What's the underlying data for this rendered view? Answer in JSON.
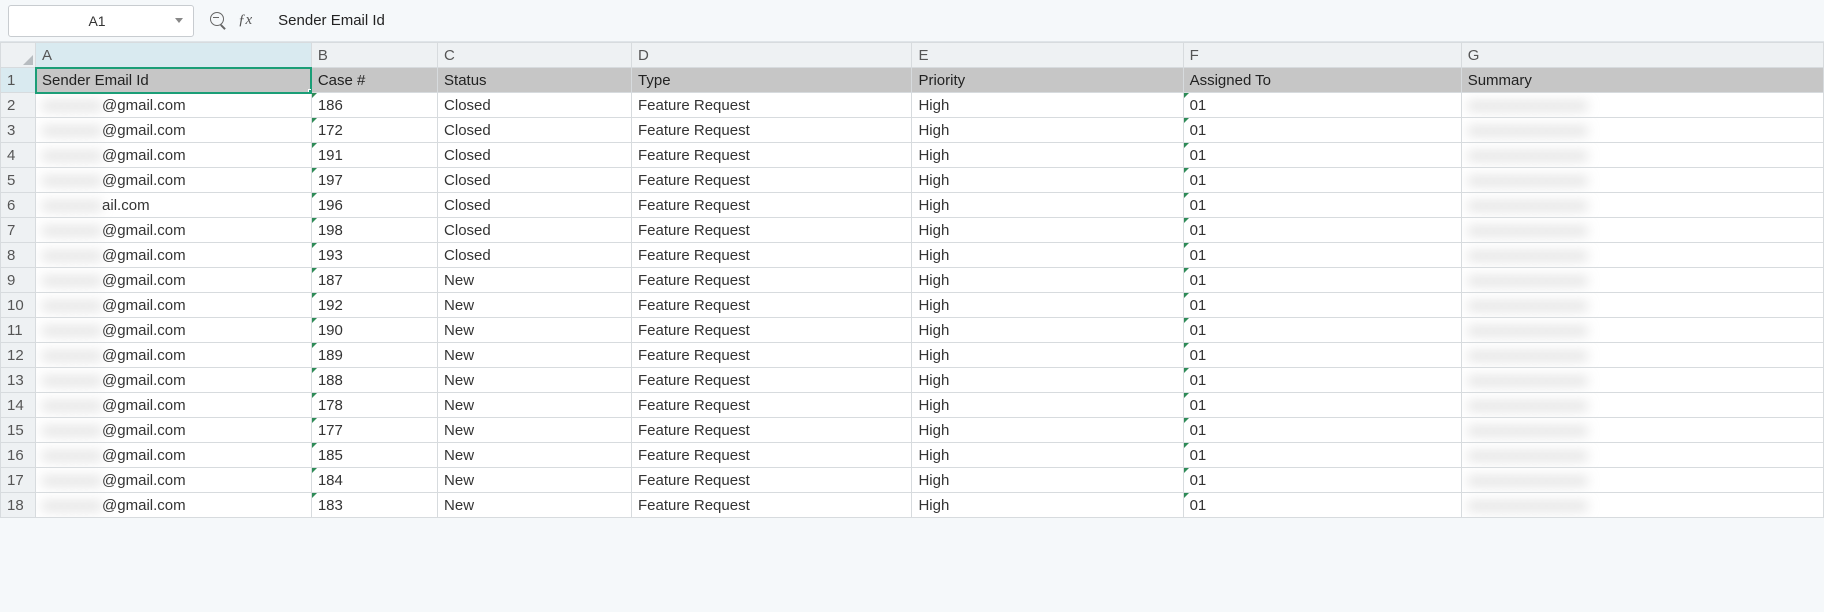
{
  "nameBox": "A1",
  "formula": "Sender Email Id",
  "columns": [
    "A",
    "B",
    "C",
    "D",
    "E",
    "F",
    "G"
  ],
  "headers": {
    "A": "Sender Email Id",
    "B": "Case #",
    "C": "Status",
    "D": "Type",
    "E": "Priority",
    "F": "Assigned To",
    "G": "Summary"
  },
  "rows": [
    {
      "n": 2,
      "email": "@gmail.com",
      "case": "186",
      "status": "Closed",
      "type": "Feature Request",
      "priority": "High",
      "assigned": "01",
      "summary": ""
    },
    {
      "n": 3,
      "email": "@gmail.com",
      "case": "172",
      "status": "Closed",
      "type": "Feature Request",
      "priority": "High",
      "assigned": "01",
      "summary": ""
    },
    {
      "n": 4,
      "email": "@gmail.com",
      "case": "191",
      "status": "Closed",
      "type": "Feature Request",
      "priority": "High",
      "assigned": "01",
      "summary": ""
    },
    {
      "n": 5,
      "email": "@gmail.com",
      "case": "197",
      "status": "Closed",
      "type": "Feature Request",
      "priority": "High",
      "assigned": "01",
      "summary": ""
    },
    {
      "n": 6,
      "email": "ail.com",
      "case": "196",
      "status": "Closed",
      "type": "Feature Request",
      "priority": "High",
      "assigned": "01",
      "summary": ""
    },
    {
      "n": 7,
      "email": "@gmail.com",
      "case": "198",
      "status": "Closed",
      "type": "Feature Request",
      "priority": "High",
      "assigned": "01",
      "summary": ""
    },
    {
      "n": 8,
      "email": "@gmail.com",
      "case": "193",
      "status": "Closed",
      "type": "Feature Request",
      "priority": "High",
      "assigned": "01",
      "summary": ""
    },
    {
      "n": 9,
      "email": "@gmail.com",
      "case": "187",
      "status": "New",
      "type": "Feature Request",
      "priority": "High",
      "assigned": "01",
      "summary": ""
    },
    {
      "n": 10,
      "email": "@gmail.com",
      "case": "192",
      "status": "New",
      "type": "Feature Request",
      "priority": "High",
      "assigned": "01",
      "summary": ""
    },
    {
      "n": 11,
      "email": "@gmail.com",
      "case": "190",
      "status": "New",
      "type": "Feature Request",
      "priority": "High",
      "assigned": "01",
      "summary": ""
    },
    {
      "n": 12,
      "email": "@gmail.com",
      "case": "189",
      "status": "New",
      "type": "Feature Request",
      "priority": "High",
      "assigned": "01",
      "summary": ""
    },
    {
      "n": 13,
      "email": "@gmail.com",
      "case": "188",
      "status": "New",
      "type": "Feature Request",
      "priority": "High",
      "assigned": "01",
      "summary": ""
    },
    {
      "n": 14,
      "email": "@gmail.com",
      "case": "178",
      "status": "New",
      "type": "Feature Request",
      "priority": "High",
      "assigned": "01",
      "summary": ""
    },
    {
      "n": 15,
      "email": "@gmail.com",
      "case": "177",
      "status": "New",
      "type": "Feature Request",
      "priority": "High",
      "assigned": "01",
      "summary": ""
    },
    {
      "n": 16,
      "email": "@gmail.com",
      "case": "185",
      "status": "New",
      "type": "Feature Request",
      "priority": "High",
      "assigned": "01",
      "summary": ""
    },
    {
      "n": 17,
      "email": "@gmail.com",
      "case": "184",
      "status": "New",
      "type": "Feature Request",
      "priority": "High",
      "assigned": "01",
      "summary": ""
    },
    {
      "n": 18,
      "email": "@gmail.com",
      "case": "183",
      "status": "New",
      "type": "Feature Request",
      "priority": "High",
      "assigned": "01",
      "summary": ""
    }
  ]
}
